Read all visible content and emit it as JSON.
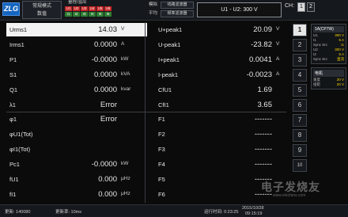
{
  "header": {
    "logo_text": "ZLG",
    "mode_line1": "常规模式",
    "mode_line2": "数值",
    "channels": [
      {
        "label": "U1",
        "color": "red"
      },
      {
        "label": "U2",
        "color": "red"
      },
      {
        "label": "U3",
        "color": "red"
      },
      {
        "label": "U4",
        "color": "red"
      },
      {
        "label": "U5",
        "color": "red"
      },
      {
        "label": "U6",
        "color": "red"
      },
      {
        "label": "I1",
        "color": "green"
      },
      {
        "label": "I2",
        "color": "green"
      },
      {
        "label": "I3",
        "color": "green"
      },
      {
        "label": "I4",
        "color": "green"
      },
      {
        "label": "I5",
        "color": "green"
      },
      {
        "label": "I6",
        "color": "green"
      }
    ],
    "scale_title": "量程/溢出",
    "range_label": "模拟",
    "filter1": "线路滤波器",
    "avg_label": "平均",
    "filter2": "频率滤波器",
    "formula": "U1 - U2: 300 V",
    "ch_label": "CH:",
    "ch_buttons": [
      "1",
      "2"
    ]
  },
  "table": {
    "rows": [
      {
        "lname": "Urms1",
        "lval": "14.03",
        "lunit": "V",
        "rname": "U+peak1",
        "rval": "20.09",
        "runit": "V",
        "highlight": true
      },
      {
        "lname": "Irms1",
        "lval": "0.0000",
        "lunit": "A",
        "rname": "U-peak1",
        "rval": "-23.82",
        "runit": "V"
      },
      {
        "lname": "P1",
        "lval": "-0.0000",
        "lunit": "kW",
        "rname": "I+peak1",
        "rval": "0.0041",
        "runit": "A"
      },
      {
        "lname": "S1",
        "lval": "0.0000",
        "lunit": "kVA",
        "rname": "I-peak1",
        "rval": "-0.0023",
        "runit": "A"
      },
      {
        "lname": "Q1",
        "lval": "0.0000",
        "lunit": "kvar",
        "rname": "CfU1",
        "rval": "1.69",
        "runit": ""
      },
      {
        "lname": "λ1",
        "lval": "Error",
        "lunit": "",
        "rname": "CfI1",
        "rval": "3.65",
        "runit": ""
      },
      {
        "lname": "φ1",
        "lval": "Error",
        "lunit": "",
        "rname": "F1",
        "rval": "-------",
        "runit": ""
      },
      {
        "lname": "φU1(Tot)",
        "lval": "",
        "lunit": "",
        "rname": "F2",
        "rval": "-------",
        "runit": ""
      },
      {
        "lname": "φI1(Tot)",
        "lval": "",
        "lunit": "",
        "rname": "F3",
        "rval": "-------",
        "runit": ""
      },
      {
        "lname": "Pc1",
        "lval": "-0.0000",
        "lunit": "kW",
        "rname": "F4",
        "rval": "-------",
        "runit": ""
      },
      {
        "lname": "fU1",
        "lval": "0.000",
        "lunit": "μHz",
        "rname": "F5",
        "rval": "-------",
        "runit": ""
      },
      {
        "lname": "fI1",
        "lval": "0.000",
        "lunit": "μHz",
        "rname": "F6",
        "rval": "-------",
        "runit": ""
      }
    ]
  },
  "pages": [
    "1",
    "2",
    "3",
    "4",
    "5",
    "6",
    "7",
    "8",
    "9",
    "10"
  ],
  "active_page": "1",
  "right_panel": {
    "group1": {
      "title": "1A(CP7W)",
      "lines": [
        {
          "k": "U1",
          "v": "300 V"
        },
        {
          "k": "I1",
          "v": "5 A"
        },
        {
          "k": "Sync Src",
          "v": "I1"
        },
        {
          "k": "U2",
          "v": "300 V"
        },
        {
          "k": "I2",
          "v": "5 A"
        },
        {
          "k": "Sync Src",
          "v": "直流"
        }
      ]
    },
    "group2": {
      "title": "电机",
      "lines": [
        {
          "k": "速度",
          "v": "20 V"
        },
        {
          "k": "扭矩",
          "v": "20 V"
        }
      ]
    }
  },
  "footer": {
    "update_count": "更新: 140080",
    "update_rate": "更新率: 10ms",
    "runtime": "运行时间: 0:23:25",
    "date": "2015/10/28",
    "time": "09:15:19"
  },
  "watermark": {
    "main": "电子发烧友",
    "sub": "www.elecfans.com"
  },
  "colors": {
    "highlight_row": "#f2f2f2",
    "ch_red": "#c62828",
    "ch_green": "#2e7d32",
    "logo": "#1565c0",
    "panel_value": "#ffd600"
  }
}
